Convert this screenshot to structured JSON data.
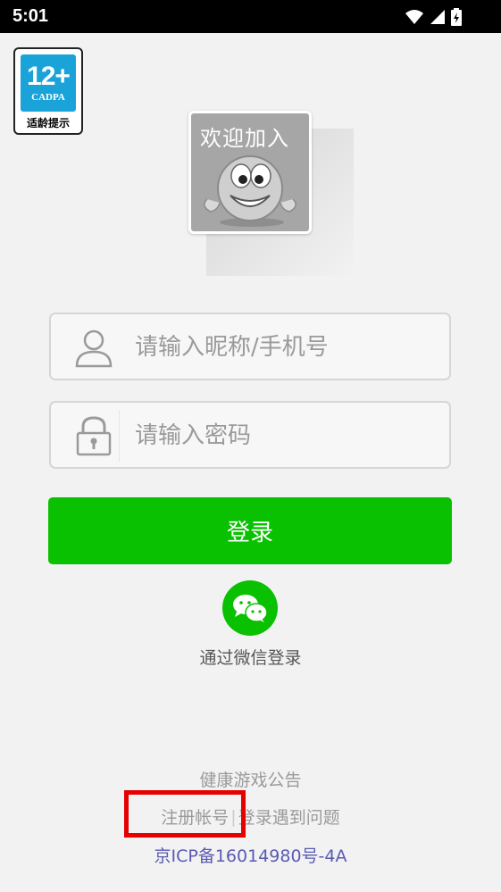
{
  "status_bar": {
    "time": "5:01"
  },
  "age_badge": {
    "age": "12+",
    "org": "CADPA",
    "hint": "适龄提示"
  },
  "avatar": {
    "text": "欢迎加入"
  },
  "login_form": {
    "username_placeholder": "请输入昵称/手机号",
    "password_placeholder": "请输入密码",
    "login_label": "登录"
  },
  "wechat": {
    "label": "通过微信登录"
  },
  "footer": {
    "health_notice": "健康游戏公告",
    "register": "注册帐号",
    "separator": "|",
    "login_problem": "登录遇到问题",
    "icp": "京ICP备16014980号-4A"
  },
  "colors": {
    "accent_green": "#09c100",
    "link_blue": "#5a5ab4",
    "highlight_red": "#e60000"
  }
}
